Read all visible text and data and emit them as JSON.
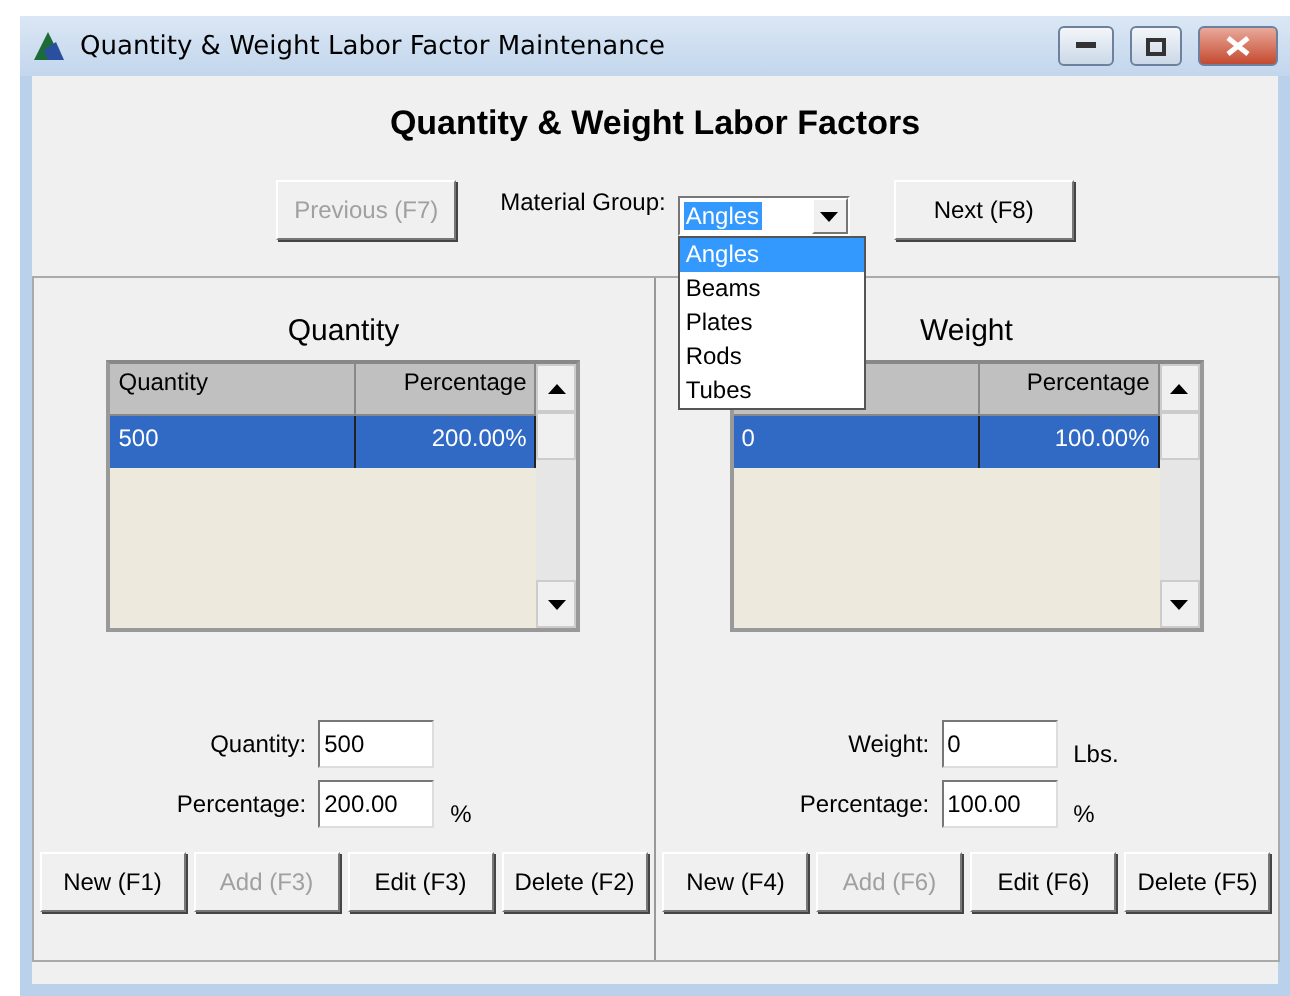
{
  "window": {
    "title": "Quantity & Weight Labor Factor Maintenance"
  },
  "heading": "Quantity & Weight Labor Factors",
  "navigation": {
    "previous": {
      "label": "Previous (F7)",
      "disabled": true
    },
    "next": {
      "label": "Next (F8)",
      "disabled": false
    },
    "material_group": {
      "label": "Material Group:",
      "value": "Angles",
      "expanded": true,
      "options": [
        {
          "label": "Angles",
          "selected": true
        },
        {
          "label": "Beams",
          "selected": false
        },
        {
          "label": "Plates",
          "selected": false
        },
        {
          "label": "Rods",
          "selected": false
        },
        {
          "label": "Tubes",
          "selected": false
        }
      ]
    }
  },
  "panels": [
    {
      "title": "Quantity",
      "columns": [
        "Quantity",
        "Percentage"
      ],
      "rows": [
        {
          "cells": [
            "500",
            "200.00%"
          ],
          "selected": true
        }
      ],
      "fields": [
        {
          "label": "Quantity:",
          "value": "500"
        },
        {
          "label": "Percentage:",
          "value": "200.00",
          "unit": "%"
        }
      ],
      "buttons": [
        {
          "label": "New (F1)",
          "disabled": false
        },
        {
          "label": "Add (F3)",
          "disabled": true
        },
        {
          "label": "Edit (F3)",
          "disabled": false
        },
        {
          "label": "Delete (F2)",
          "disabled": false
        }
      ]
    },
    {
      "title": "Weight",
      "columns": [
        "",
        "Percentage"
      ],
      "rows": [
        {
          "cells": [
            "0",
            "100.00%"
          ],
          "selected": true
        }
      ],
      "fields": [
        {
          "label": "Weight:",
          "value": "0",
          "unit": "Lbs."
        },
        {
          "label": "Percentage:",
          "value": "100.00",
          "unit": "%"
        }
      ],
      "buttons": [
        {
          "label": "New (F4)",
          "disabled": false
        },
        {
          "label": "Add (F6)",
          "disabled": true
        },
        {
          "label": "Edit (F6)",
          "disabled": false
        },
        {
          "label": "Delete (F5)",
          "disabled": false
        }
      ]
    }
  ]
}
